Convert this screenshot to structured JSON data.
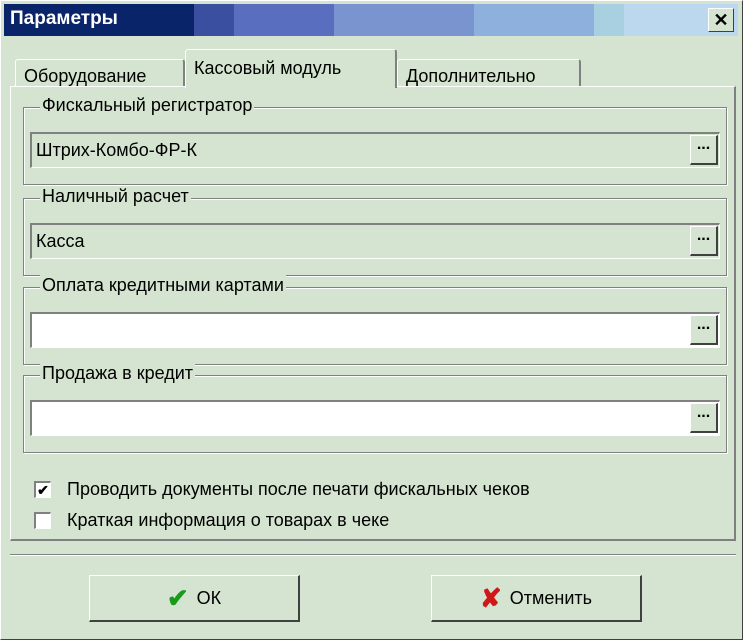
{
  "window": {
    "title": "Параметры",
    "close_glyph": "✕"
  },
  "tabs": [
    {
      "label": "Оборудование",
      "active": false
    },
    {
      "label": "Кассовый модуль",
      "active": true
    },
    {
      "label": "Дополнительно",
      "active": false
    }
  ],
  "groups": {
    "fiscal": {
      "label": "Фискальный регистратор",
      "value": "Штрих-Комбо-ФР-К"
    },
    "cash": {
      "label": "Наличный расчет",
      "value": "Касса"
    },
    "card": {
      "label": "Оплата кредитными картами",
      "value": ""
    },
    "credit": {
      "label": "Продажа в кредит",
      "value": ""
    }
  },
  "ellipsis_label": "...",
  "checkboxes": [
    {
      "label": "Проводить документы после печати фискальных чеков",
      "checked": true,
      "glyph": "✔"
    },
    {
      "label": "Краткая информация о товарах в чеке",
      "checked": false,
      "glyph": ""
    }
  ],
  "buttons": {
    "ok": {
      "label": "ОК",
      "icon": "check-icon",
      "glyph": "✔",
      "color": "#1a9a1a"
    },
    "cancel": {
      "label": "Отменить",
      "icon": "x-icon",
      "glyph": "✘",
      "color": "#d01818"
    }
  }
}
